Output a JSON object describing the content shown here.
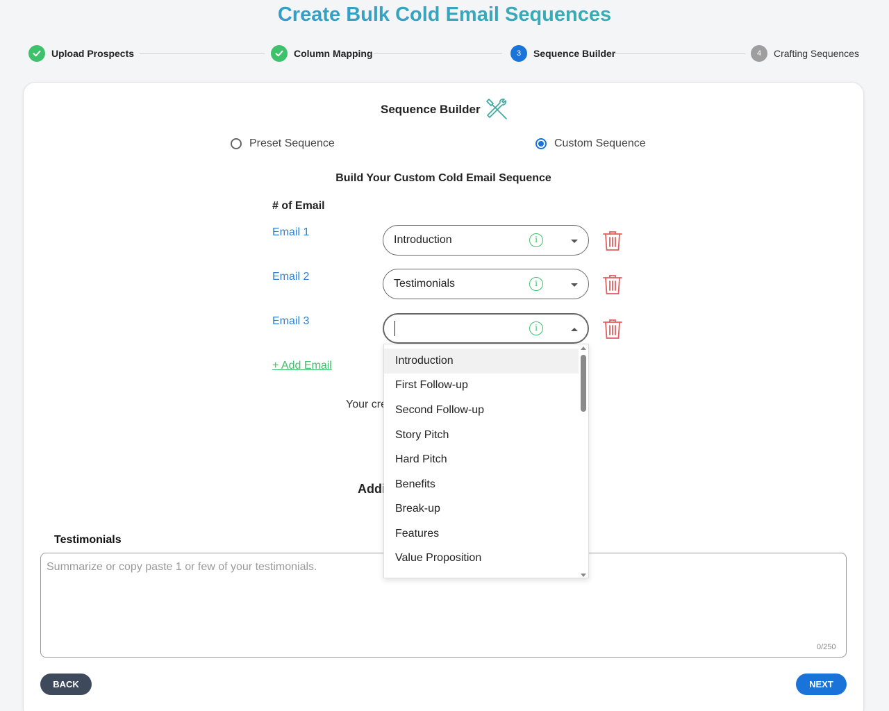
{
  "page": {
    "title": "Create Bulk Cold Email Sequences"
  },
  "stepper": {
    "steps": [
      {
        "label": "Upload Prospects",
        "state": "done"
      },
      {
        "label": "Column Mapping",
        "state": "done"
      },
      {
        "label": "Sequence Builder",
        "state": "active",
        "number": "3"
      },
      {
        "label": "Crafting Sequences",
        "state": "todo",
        "number": "4"
      }
    ]
  },
  "builder": {
    "title": "Sequence Builder",
    "icon": "tools-icon",
    "mode_options": [
      {
        "label": "Preset Sequence",
        "selected": false
      },
      {
        "label": "Custom Sequence",
        "selected": true
      }
    ],
    "build_title": "Build Your Custom Cold Email Sequence",
    "count_label": "# of Email",
    "emails": [
      {
        "label": "Email 1",
        "value": "Introduction"
      },
      {
        "label": "Email 2",
        "value": "Testimonials"
      },
      {
        "label": "Email 3",
        "value": ""
      }
    ],
    "add_email_label": "+ Add Email",
    "partial_text": "Your cre",
    "partial_heading": "Addi"
  },
  "dropdown": {
    "options": [
      "Introduction",
      "First Follow-up",
      "Second Follow-up",
      "Story Pitch",
      "Hard Pitch",
      "Benefits",
      "Break-up",
      "Features",
      "Value Proposition"
    ],
    "highlighted": "Introduction"
  },
  "testimonials": {
    "label": "Testimonials",
    "placeholder": "Summarize or copy paste 1 or few of your testimonials.",
    "counter": "0/250"
  },
  "actions": {
    "back_label": "BACK",
    "next_label": "NEXT"
  },
  "colors": {
    "accent": "#1a73d9",
    "success": "#3dc26b",
    "danger": "#e35d5d",
    "back": "#3e4a5c"
  }
}
